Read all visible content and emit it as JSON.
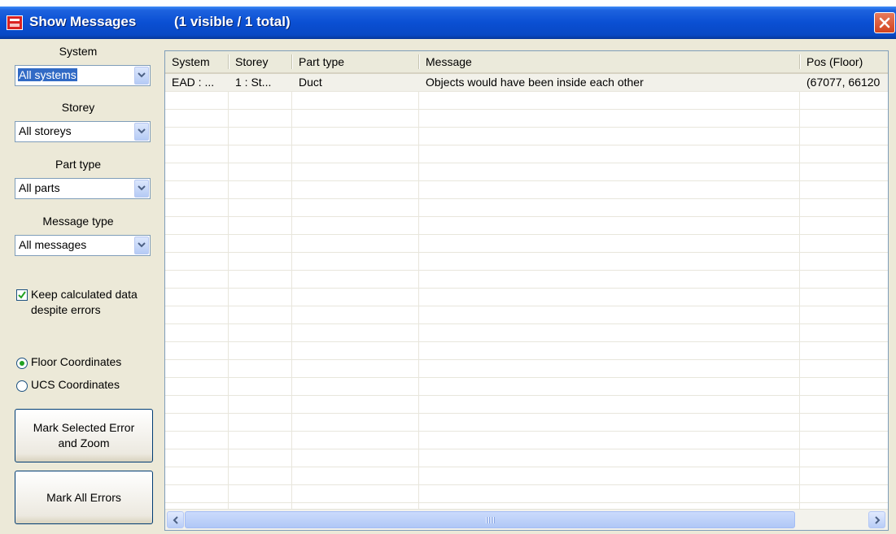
{
  "window": {
    "title": "Show Messages",
    "count_text": "(1 visible / 1 total)"
  },
  "filters": {
    "system": {
      "label": "System",
      "value": "All systems"
    },
    "storey": {
      "label": "Storey",
      "value": "All storeys"
    },
    "part_type": {
      "label": "Part type",
      "value": "All parts"
    },
    "message_type": {
      "label": "Message type",
      "value": "All messages"
    }
  },
  "options": {
    "keep_calculated": {
      "label": "Keep calculated data despite errors",
      "checked": true
    },
    "coordinates": [
      {
        "label": "Floor Coordinates",
        "selected": true
      },
      {
        "label": "UCS Coordinates",
        "selected": false
      }
    ]
  },
  "buttons": {
    "mark_selected": "Mark Selected Error and Zoom",
    "mark_all": "Mark All Errors"
  },
  "table": {
    "columns": [
      "System",
      "Storey",
      "Part type",
      "Message",
      "Pos (Floor)"
    ],
    "rows": [
      [
        "EAD : ...",
        "1 : St...",
        "Duct",
        "Objects would have been inside each other",
        "(67077, 66120"
      ]
    ]
  },
  "colors": {
    "title_bar": "#0a4fd3",
    "window_bg": "#ece9d8",
    "close_button": "#d2431f",
    "selection": "#316ac5"
  }
}
